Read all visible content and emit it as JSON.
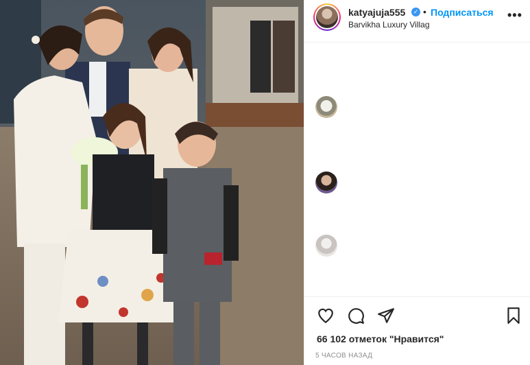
{
  "post": {
    "username": "katyajuja555",
    "verified_icon": "verified-badge-icon",
    "separator": "•",
    "follow_label": "Подписаться",
    "location": "Barvikha Luxury Villag",
    "more_label": "•••"
  },
  "comments": {
    "avatar_icons": [
      "comment-avatar",
      "comment-avatar",
      "comment-avatar"
    ]
  },
  "actions": {
    "like_icon": "heart-icon",
    "comment_icon": "comment-icon",
    "share_icon": "share-icon",
    "save_icon": "bookmark-icon"
  },
  "likes_text": "66 102 отметок \"Нравится\"",
  "time_text": "5 ЧАСОВ НАЗАД",
  "colors": {
    "follow_blue": "#0095f6",
    "verified_blue": "#3897f0",
    "text": "#262626",
    "muted": "#8e8e8e"
  }
}
